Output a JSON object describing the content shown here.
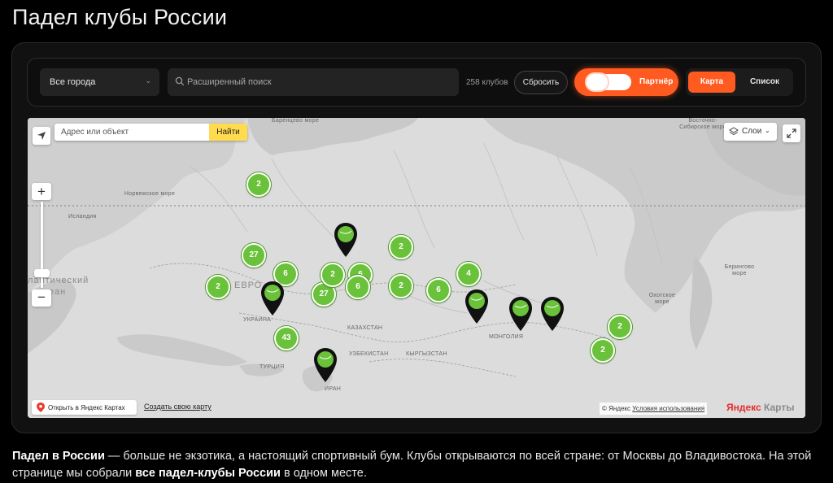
{
  "page": {
    "title": "Падел клубы России"
  },
  "filters": {
    "city_select_value": "Все города",
    "search_placeholder": "Расширенный поиск",
    "club_count": "258 клубов",
    "reset_label": "Сбросить",
    "partner_label": "Партнёр",
    "view_tabs": {
      "map": "Карта",
      "list": "Список"
    }
  },
  "map": {
    "address_placeholder": "Адрес или объект",
    "find_label": "Найти",
    "zoom_in": "+",
    "zoom_out": "−",
    "layers_label": "Слои",
    "open_in_yandex": "Открыть в Яндекс Картах",
    "create_map": "Создать свою карту",
    "copyright": "© Яндекс",
    "terms": "Условия использования",
    "logo_y": "Яндекс",
    "logo_rest": " Карты",
    "labels": {
      "barents": "Баренцево море",
      "norwegian": "Норвежское море",
      "iceland": "Исландия",
      "atlantic1": "лантический",
      "atlantic2": "кеан",
      "east_siberian": "Восточно-Сибирское море",
      "bering": "Берингово море",
      "okhotsk": "Охотское море",
      "europe": "ЕВРО",
      "ukraine": "УКРАИНА",
      "kazakhstan": "КАЗАХСТАН",
      "mongolia": "МОНГОЛИЯ",
      "turkey": "ТУРЦИЯ",
      "iran": "ИРАН",
      "kyrgyzstan": "КЫРГЫЗСТАН",
      "uzbekistan": "УЗБЕКИСТАН"
    },
    "clusters": [
      "2",
      "27",
      "6",
      "2",
      "27",
      "6",
      "2",
      "2",
      "6",
      "4",
      "43",
      "2",
      "2",
      "2"
    ]
  },
  "description": {
    "lead": "Падел в России",
    "text1": " — больше не экзотика, а настоящий спортивный бум. Клубы открываются по всей стране: от Москвы до Владивостока. На этой странице мы собрали ",
    "highlight": "все падел-клубы России",
    "text2": " в одном месте."
  },
  "colors": {
    "accent": "#ff5a1f",
    "cluster_green": "#6ac13a",
    "find_yellow": "#ffdb4d"
  }
}
